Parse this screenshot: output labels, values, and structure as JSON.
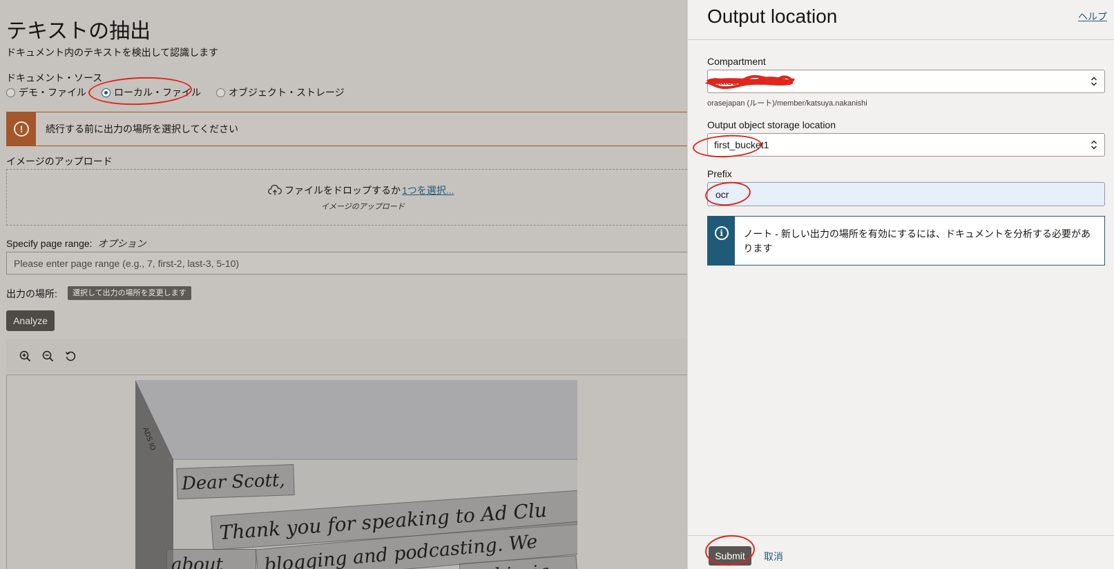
{
  "background": {
    "title": "テキストの抽出",
    "subtitle": "ドキュメント内のテキストを検出して認識します",
    "source_label": "ドキュメント・ソース",
    "sources": [
      {
        "label": "デモ・ファイル",
        "checked": false
      },
      {
        "label": "ローカル・ファイル",
        "checked": true
      },
      {
        "label": "オブジェクト・ストレージ",
        "checked": false
      }
    ],
    "warning": "続行する前に出力の場所を選択してください",
    "upload_label": "イメージのアップロード",
    "drop_text": "ファイルをドロップするか",
    "drop_link": "1つを選択...",
    "drop_sub": "イメージのアップロード",
    "range_label": "Specify page range:",
    "range_optional": "オプション",
    "range_placeholder": "Please enter page range (e.g., 7, first-2, last-3, 5-10)",
    "output_label": "出力の場所:",
    "output_tag": "選択して出力の場所を変更します",
    "analyze": "Analyze",
    "handwriting": {
      "line1": "Dear Scott,",
      "line2": "Thank you for speaking to Ad Clu",
      "line3": "blogging and podcasting. We",
      "line4": "about",
      "line5": "and insig",
      "corner_text": "ADS IO"
    }
  },
  "panel": {
    "title": "Output location",
    "help": "ヘルプ",
    "compartment_label": "Compartment",
    "compartment_value": "katsuya.nakanishi",
    "compartment_path": "orasejapan (ルート)/member/katsuya.nakanishi",
    "storage_label": "Output object storage location",
    "storage_value": "first_bucket1",
    "prefix_label": "Prefix",
    "prefix_value": "ocr",
    "note": "ノート - 新しい出力の場所を有効にするには、ドキュメントを分析する必要があります",
    "submit": "Submit",
    "cancel": "取消"
  },
  "colors": {
    "accent": "#1f5b78",
    "warning": "#a3572a",
    "annotation": "#e1251b"
  }
}
